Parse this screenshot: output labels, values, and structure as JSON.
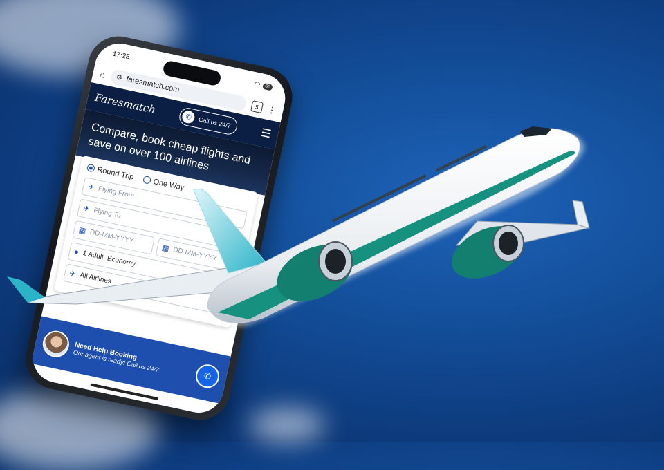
{
  "status": {
    "time": "17:25",
    "battery": "66"
  },
  "browser": {
    "url": "faresmatch.com",
    "tab_count": "5"
  },
  "site": {
    "logo": "Faresmatch",
    "call_label": "Call us 24/7",
    "hero_title": "Compare, book cheap flights and save on over 100 airlines"
  },
  "form": {
    "trip_round": "Round Trip",
    "trip_oneway": "One Way",
    "flying_from_placeholder": "Flying From",
    "flying_to_placeholder": "Flying To",
    "depart_placeholder": "DD-MM-YYYY",
    "return_placeholder": "DD-MM-YYYY",
    "travelers": "1 Adult, Economy",
    "airlines": "All Airlines"
  },
  "help": {
    "title": "Need Help Booking",
    "subtitle": "Our agent is ready! Call us 24/7"
  },
  "colors": {
    "sky": "#134f9b",
    "header": "#0b1f44",
    "help_bar": "#1f4fae",
    "accent": "#1a4fb8"
  },
  "icons": [
    "home-icon",
    "tune-icon",
    "menu-icon",
    "phone-icon",
    "plane-icon",
    "calendar-icon",
    "user-icon",
    "chevron-down-icon"
  ]
}
